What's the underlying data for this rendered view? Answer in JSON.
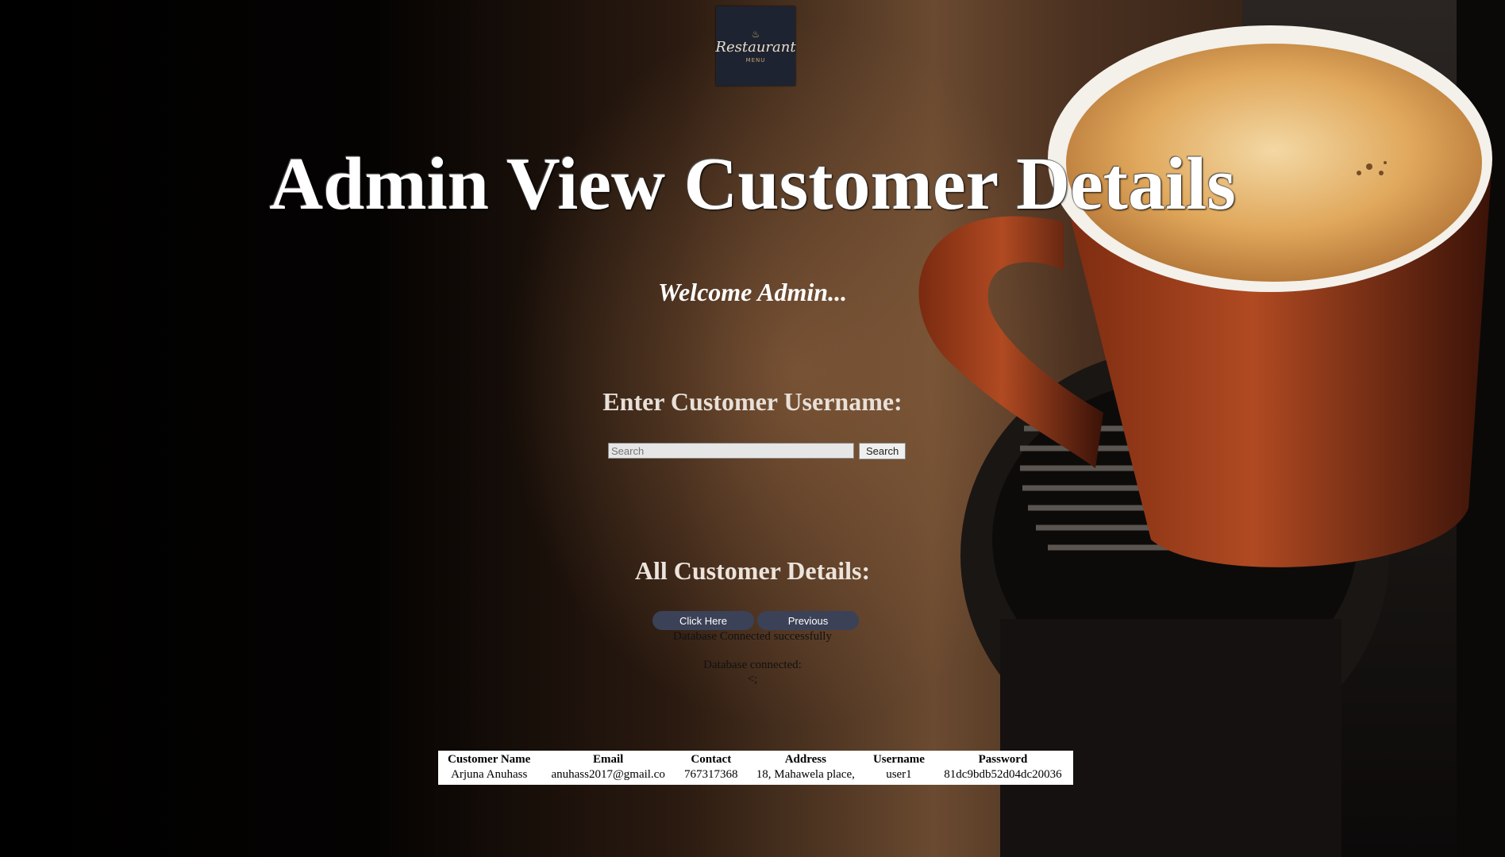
{
  "logo": {
    "script_text": "Restaurant",
    "small_text": "MENU"
  },
  "page": {
    "title": "Admin View Customer Details",
    "welcome": "Welcome Admin..."
  },
  "search": {
    "heading": "Enter Customer Username:",
    "placeholder": "Search",
    "button_label": "Search"
  },
  "customers": {
    "heading": "All Customer Details:",
    "click_here_label": "Click Here",
    "previous_label": "Previous",
    "status_db_success": "Database Connected successfully",
    "status_db_connected": "Database connected:",
    "status_stray": "<;"
  },
  "table": {
    "columns": [
      "Customer Name",
      "Email",
      "Contact",
      "Address",
      "Username",
      "Password"
    ],
    "rows": [
      [
        "Arjuna Anuhass",
        "anuhass2017@gmail.co",
        "767317368",
        "18, Mahawela place,",
        "user1",
        "81dc9bdb52d04dc20036"
      ]
    ]
  }
}
